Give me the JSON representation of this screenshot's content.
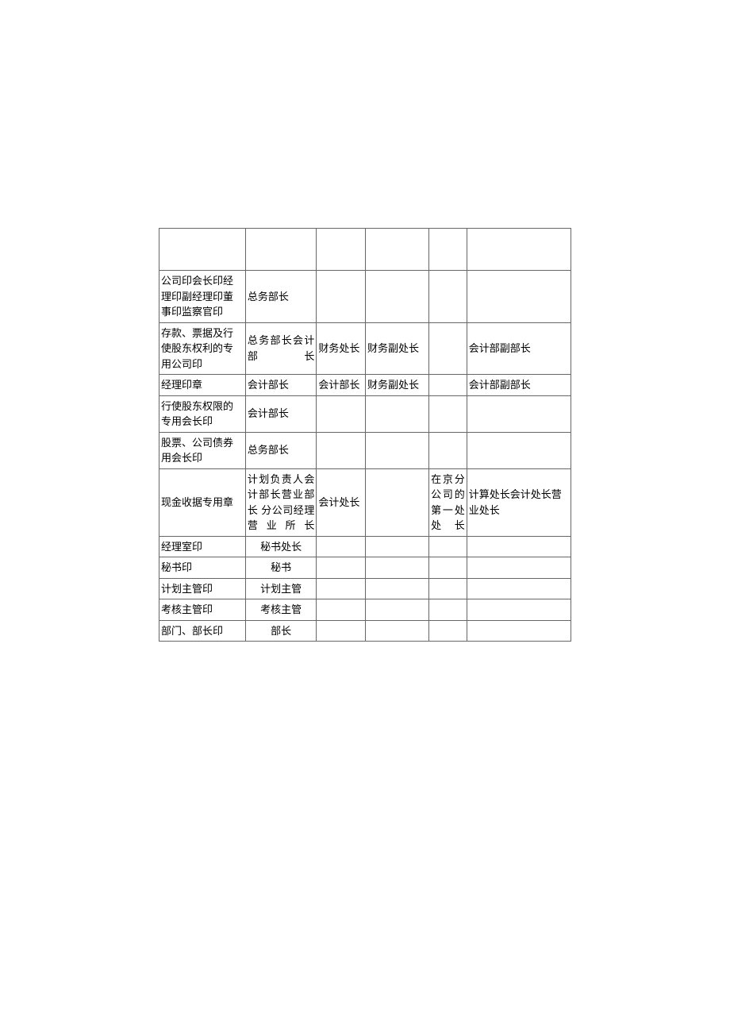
{
  "rows": [
    {
      "c1": "公司印会长印经理印副经理印董事印监察官印",
      "c2": "总务部长",
      "c3": "",
      "c4": "",
      "c5": "",
      "c6": ""
    },
    {
      "c1": "存款、票据及行使股东权利的专用公司印",
      "c2": "总务部长会计部长",
      "c3": "财务处长",
      "c4": "财务副处长",
      "c5": "",
      "c6": "会计部副部长"
    },
    {
      "c1": "经理印章",
      "c2": "会计部长",
      "c3": "会计部长",
      "c4": "财务副处长",
      "c5": "",
      "c6": "会计部副部长"
    },
    {
      "c1": "行使股东权限的专用会长印",
      "c2": "会计部长",
      "c3": "",
      "c4": "",
      "c5": "",
      "c6": ""
    },
    {
      "c1": "股票、公司债券\n用会长印",
      "c2": "总务部长",
      "c3": "",
      "c4": "",
      "c5": "",
      "c6": ""
    },
    {
      "c1": "现金收据专用章",
      "c2": "计划负责人会计部长营业部长\n分公司经理营业所长",
      "c3": "会计处长",
      "c4": "",
      "c5": "在京分公司的第一处处长",
      "c6": "计算处长会计处长营业处长"
    },
    {
      "c1": "经理室印",
      "c2": "秘书处长",
      "c3": "",
      "c4": "",
      "c5": "",
      "c6": ""
    },
    {
      "c1": "秘书印",
      "c2": "秘书",
      "c3": "",
      "c4": "",
      "c5": "",
      "c6": ""
    },
    {
      "c1": "计划主管印",
      "c2": "计划主管",
      "c3": "",
      "c4": "",
      "c5": "",
      "c6": ""
    },
    {
      "c1": "考核主管印",
      "c2": "考核主管",
      "c3": "",
      "c4": "",
      "c5": "",
      "c6": ""
    },
    {
      "c1": "部门、部长印",
      "c2": "部长",
      "c3": "",
      "c4": "",
      "c5": "",
      "c6": ""
    }
  ]
}
